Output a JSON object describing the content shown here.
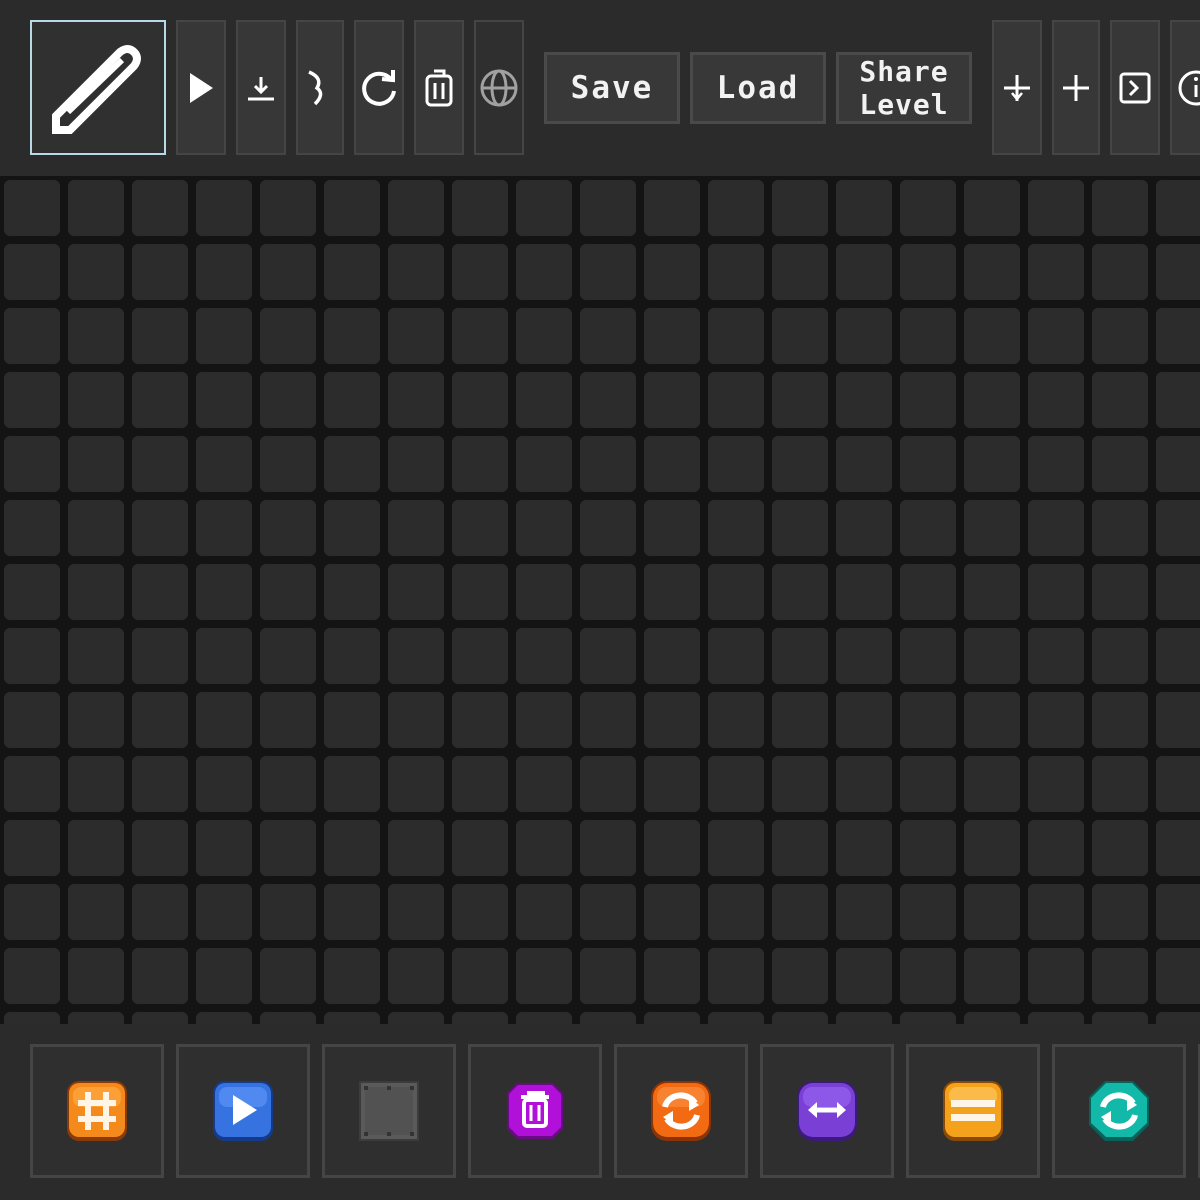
{
  "toolbar": {
    "tools": [
      {
        "name": "pencil-tool",
        "icon": "pencil-icon",
        "selected": true
      },
      {
        "name": "play-button",
        "icon": "play-icon"
      },
      {
        "name": "download-button",
        "icon": "download-icon"
      },
      {
        "name": "music-button",
        "icon": "music-note-icon"
      },
      {
        "name": "reset-button",
        "icon": "refresh-icon"
      },
      {
        "name": "clear-button",
        "icon": "trash-icon"
      },
      {
        "name": "web-button",
        "icon": "globe-icon",
        "disabled": true
      }
    ],
    "save_label": "Save",
    "load_label": "Load",
    "share_label": "Share\nLevel",
    "extra_tools": [
      {
        "name": "add-button-1",
        "icon": "plus-icon"
      },
      {
        "name": "add-button-2",
        "icon": "plus-icon"
      },
      {
        "name": "console-button",
        "icon": "terminal-icon"
      },
      {
        "name": "info-button",
        "icon": "info-icon"
      }
    ]
  },
  "palette": {
    "items": [
      {
        "name": "palette-grid-block",
        "icon": "hash-icon",
        "color": "#f48a1c"
      },
      {
        "name": "palette-play-block",
        "icon": "play-icon",
        "color": "#3673e0"
      },
      {
        "name": "palette-wall-block",
        "icon": "metal-plate-icon",
        "color": "#5a5a5a"
      },
      {
        "name": "palette-delete-block",
        "icon": "trash-icon",
        "color": "#b010d8"
      },
      {
        "name": "palette-rotate-block",
        "icon": "rotate-icon",
        "color": "#f26a12"
      },
      {
        "name": "palette-swap-block",
        "icon": "double-arrow-icon",
        "color": "#7a3fd4"
      },
      {
        "name": "palette-lines-block",
        "icon": "lines-icon",
        "color": "#f4a21c"
      },
      {
        "name": "palette-cycle-block",
        "icon": "cycle-icon",
        "color": "#12b8a8"
      }
    ]
  },
  "colors": {
    "toolbar_bg": "#2b2b2b",
    "grid_bg": "#141414",
    "cell": "#2c2c2c",
    "selected_border": "#b7dbe6",
    "text": "#f2f2f2"
  }
}
